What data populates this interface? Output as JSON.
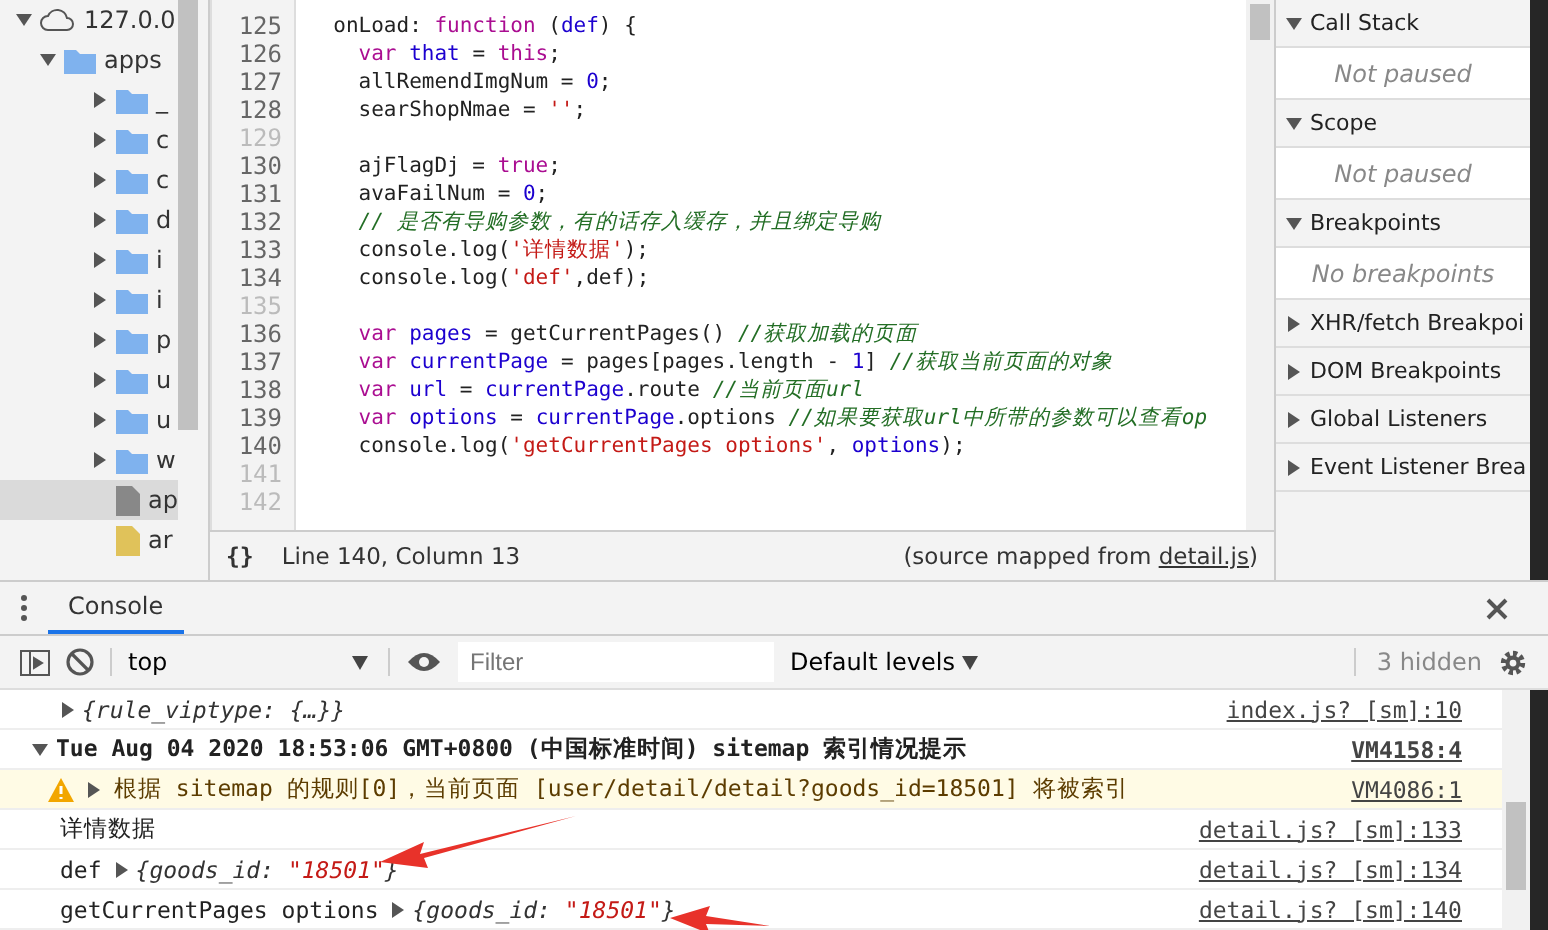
{
  "file_tree": {
    "root": {
      "label": "127.0.0",
      "expanded": true,
      "children": [
        {
          "label": "apps",
          "kind": "folder",
          "expanded": true,
          "children": [
            {
              "label": "_",
              "kind": "folder",
              "expanded": false,
              "selected": false
            },
            {
              "label": "c",
              "kind": "folder",
              "expanded": false,
              "selected": false
            },
            {
              "label": "c",
              "kind": "folder",
              "expanded": false,
              "selected": false
            },
            {
              "label": "d",
              "kind": "folder",
              "expanded": false,
              "selected": false
            },
            {
              "label": "i",
              "kind": "folder",
              "expanded": false,
              "selected": false
            },
            {
              "label": "i",
              "kind": "folder",
              "expanded": false,
              "selected": false
            },
            {
              "label": "p",
              "kind": "folder",
              "expanded": false,
              "selected": false
            },
            {
              "label": "u",
              "kind": "folder",
              "expanded": false,
              "selected": false
            },
            {
              "label": "u",
              "kind": "folder",
              "expanded": false,
              "selected": false
            },
            {
              "label": "w",
              "kind": "folder",
              "expanded": false,
              "selected": false
            },
            {
              "label": "ap",
              "kind": "file",
              "selected": true
            },
            {
              "label": "ar",
              "kind": "script",
              "selected": false
            }
          ]
        }
      ]
    }
  },
  "editor": {
    "lines": [
      {
        "number": "125",
        "tokens": [
          {
            "text": "  onLoad: ",
            "kind": "plain"
          },
          {
            "text": "function",
            "kind": "keyword"
          },
          {
            "text": " (",
            "kind": "plain"
          },
          {
            "text": "def",
            "kind": "variable"
          },
          {
            "text": ") {",
            "kind": "plain"
          }
        ]
      },
      {
        "number": "126",
        "tokens": [
          {
            "text": "    var",
            "kind": "keyword"
          },
          {
            "text": " that",
            "kind": "variable"
          },
          {
            "text": " = ",
            "kind": "plain"
          },
          {
            "text": "this",
            "kind": "keyword"
          },
          {
            "text": ";",
            "kind": "plain"
          }
        ]
      },
      {
        "number": "127",
        "tokens": [
          {
            "text": "    allRemendImgNum = ",
            "kind": "plain"
          },
          {
            "text": "0",
            "kind": "number"
          },
          {
            "text": ";",
            "kind": "plain"
          }
        ]
      },
      {
        "number": "128",
        "tokens": [
          {
            "text": "    searShopNmae = ",
            "kind": "plain"
          },
          {
            "text": "''",
            "kind": "string"
          },
          {
            "text": ";",
            "kind": "plain"
          }
        ]
      },
      {
        "number": "129"
      },
      {
        "number": "130",
        "tokens": [
          {
            "text": "    ajFlagDj = ",
            "kind": "plain"
          },
          {
            "text": "true",
            "kind": "keyword"
          },
          {
            "text": ";",
            "kind": "plain"
          }
        ]
      },
      {
        "number": "131",
        "tokens": [
          {
            "text": "    avaFailNum = ",
            "kind": "plain"
          },
          {
            "text": "0",
            "kind": "number"
          },
          {
            "text": ";",
            "kind": "plain"
          }
        ]
      },
      {
        "number": "132",
        "tokens": [
          {
            "text": "    // 是否有导购参数，有的话存入缓存，并且绑定导购",
            "kind": "comment"
          }
        ]
      },
      {
        "number": "133",
        "tokens": [
          {
            "text": "    console.log(",
            "kind": "plain"
          },
          {
            "text": "'详情数据'",
            "kind": "string"
          },
          {
            "text": ");",
            "kind": "plain"
          }
        ]
      },
      {
        "number": "134",
        "tokens": [
          {
            "text": "    console.log(",
            "kind": "plain"
          },
          {
            "text": "'def'",
            "kind": "string"
          },
          {
            "text": ",def);",
            "kind": "plain"
          }
        ]
      },
      {
        "number": "135"
      },
      {
        "number": "136",
        "tokens": [
          {
            "text": "    var",
            "kind": "keyword"
          },
          {
            "text": " pages",
            "kind": "variable"
          },
          {
            "text": " = getCurrentPages() ",
            "kind": "plain"
          },
          {
            "text": "//获取加载的页面",
            "kind": "comment"
          }
        ]
      },
      {
        "number": "137",
        "tokens": [
          {
            "text": "    var",
            "kind": "keyword"
          },
          {
            "text": " currentPage",
            "kind": "variable"
          },
          {
            "text": " = pages[pages.length - ",
            "kind": "plain"
          },
          {
            "text": "1",
            "kind": "number"
          },
          {
            "text": "] ",
            "kind": "plain"
          },
          {
            "text": "//获取当前页面的对象",
            "kind": "comment"
          }
        ]
      },
      {
        "number": "138",
        "tokens": [
          {
            "text": "    var",
            "kind": "keyword"
          },
          {
            "text": " url",
            "kind": "variable"
          },
          {
            "text": " = ",
            "kind": "plain"
          },
          {
            "text": "currentPage",
            "kind": "variable"
          },
          {
            "text": ".route ",
            "kind": "plain"
          },
          {
            "text": "//当前页面url",
            "kind": "comment"
          }
        ]
      },
      {
        "number": "139",
        "tokens": [
          {
            "text": "    var",
            "kind": "keyword"
          },
          {
            "text": " options",
            "kind": "variable"
          },
          {
            "text": " = ",
            "kind": "plain"
          },
          {
            "text": "currentPage",
            "kind": "variable"
          },
          {
            "text": ".options ",
            "kind": "plain"
          },
          {
            "text": "//如果要获取url中所带的参数可以查看op",
            "kind": "comment"
          }
        ]
      },
      {
        "number": "140",
        "tokens": [
          {
            "text": "    console.log(",
            "kind": "plain"
          },
          {
            "text": "'getCurrentPages options'",
            "kind": "string"
          },
          {
            "text": ", ",
            "kind": "plain"
          },
          {
            "text": "options",
            "kind": "variable"
          },
          {
            "text": ");",
            "kind": "plain"
          }
        ]
      },
      {
        "number": "141"
      },
      {
        "number": "142"
      }
    ]
  },
  "status_bar": {
    "braces": "{}",
    "position": "Line 140, Column 13",
    "source_prefix": "(source mapped from ",
    "source_link": "detail.js",
    "source_suffix": ")"
  },
  "debugger": {
    "sections": [
      {
        "title": "Call Stack",
        "expanded": true,
        "body": "Not paused"
      },
      {
        "title": "Scope",
        "expanded": true,
        "body": "Not paused"
      },
      {
        "title": "Breakpoints",
        "expanded": true,
        "body": "No breakpoints"
      },
      {
        "title": "XHR/fetch Breakpoi",
        "expanded": false
      },
      {
        "title": "DOM Breakpoints",
        "expanded": false
      },
      {
        "title": "Global Listeners",
        "expanded": false
      },
      {
        "title": "Event Listener Brea",
        "expanded": false
      }
    ]
  },
  "drawer": {
    "tabs": [
      {
        "label": "Console",
        "selected": true
      }
    ],
    "toolbar": {
      "context": "top",
      "filter_placeholder": "Filter",
      "levels": "Default levels",
      "hidden": "3 hidden"
    },
    "messages": [
      {
        "kind": "object",
        "object": "{rule_viptype: {…}}",
        "source": "index.js? [sm]:10"
      },
      {
        "kind": "group",
        "text": "Tue Aug 04 2020 18:53:06 GMT+0800 (中国标准时间) sitemap 索引情况提示",
        "source": "VM4158:4"
      },
      {
        "kind": "warning",
        "text": "根据 sitemap 的规则[0]，当前页面 [user/detail/detail?goods_id=18501] 将被索引",
        "source": "VM4086:1"
      },
      {
        "kind": "text",
        "text": "详情数据",
        "source": "detail.js? [sm]:133"
      },
      {
        "kind": "object",
        "prefix": "def",
        "object_key": "{goods_id: ",
        "object_value": "\"18501\"",
        "object_end": "}",
        "source": "detail.js? [sm]:134"
      },
      {
        "kind": "object",
        "prefix": "getCurrentPages options",
        "object_key": "{goods_id: ",
        "object_value": "\"18501\"",
        "object_end": "}",
        "source": "detail.js? [sm]:140"
      }
    ]
  }
}
